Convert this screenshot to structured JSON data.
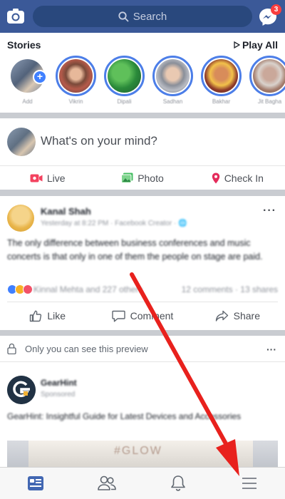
{
  "header": {
    "search_placeholder": "Search",
    "messenger_badge": "3"
  },
  "stories": {
    "title": "Stories",
    "play_all": "Play All",
    "items": [
      {
        "name": "Add"
      },
      {
        "name": "Vikrin"
      },
      {
        "name": "Dipali"
      },
      {
        "name": "Sadhan"
      },
      {
        "name": "Bakhar"
      },
      {
        "name": "Jit Bagha"
      }
    ]
  },
  "composer": {
    "prompt": "What's on your mind?",
    "live": "Live",
    "photo": "Photo",
    "check_in": "Check In"
  },
  "post": {
    "author": "Kanal Shah",
    "meta": "Yesterday at 8:22 PM · Facebook Creator · ",
    "text": "The only difference between business conferences and music concerts is that only in one of them the people on stage are paid.",
    "reactions": "Kinnal Mehta and 227 others",
    "counts": "12 comments · 13 shares",
    "like": "Like",
    "comment": "Comment",
    "share": "Share"
  },
  "ad": {
    "preview_notice": "Only you can see this preview",
    "advertiser": "GearHint",
    "sponsored": "Sponsored",
    "text": "GearHint: Insightful Guide for Latest Devices and Accessories",
    "image_text": "#GLOW"
  },
  "colors": {
    "brand": "#3b5998",
    "link_blue": "#4c7ee8",
    "annotation_arrow": "#e8211d"
  }
}
